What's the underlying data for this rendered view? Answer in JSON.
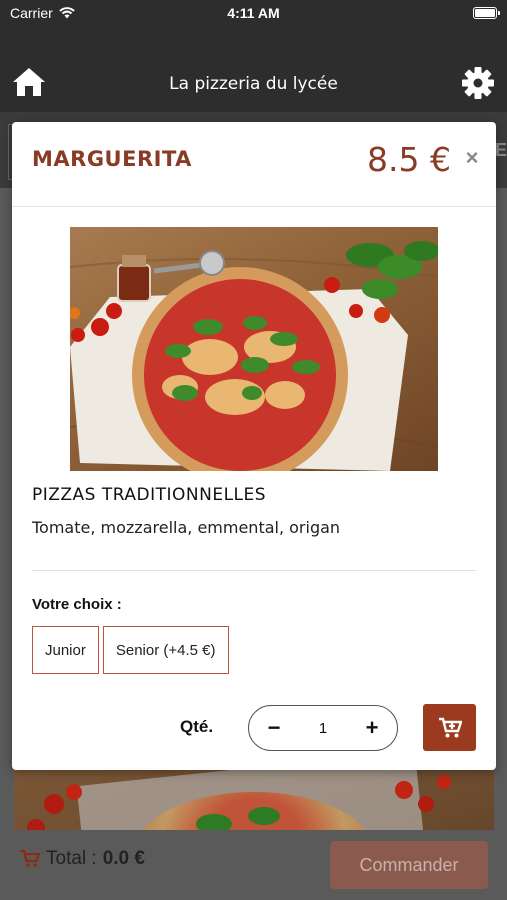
{
  "status_bar": {
    "carrier": "Carrier",
    "time": "4:11 AM"
  },
  "header": {
    "title": "La pizzeria du lycée",
    "home_icon": "home-icon",
    "settings_icon": "gear-icon"
  },
  "background_tabs": {
    "partial_text": "E"
  },
  "modal": {
    "title": "MARGUERITA",
    "price": "8.5 €",
    "close_label": "×",
    "category": "PIZZAS TRADITIONNELLES",
    "description": "Tomate, mozzarella, emmental, origan",
    "choice_label": "Votre choix :",
    "options": [
      {
        "label": "Junior"
      },
      {
        "label": "Senior (+4.5 €)"
      }
    ],
    "quantity_label": "Qté.",
    "quantity": "1",
    "decrement_label": "−",
    "increment_label": "+"
  },
  "bottom_bar": {
    "total_label": "Total :",
    "total_value": "0.0 €",
    "order_button": "Commander"
  },
  "colors": {
    "accent": "#9b3a1f",
    "title_color": "#8a3b26",
    "header_bg": "#2d2d2d"
  }
}
